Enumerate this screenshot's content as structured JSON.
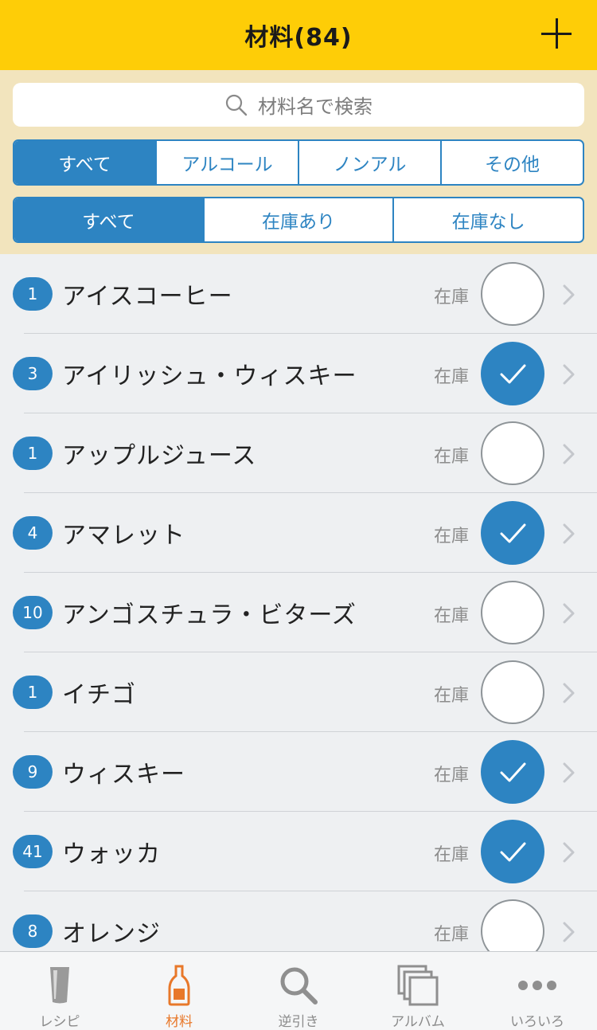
{
  "header": {
    "title": "材料(84)",
    "add_icon": "plus-icon"
  },
  "search": {
    "placeholder": "材料名で検索",
    "icon": "search-icon"
  },
  "category_filter": {
    "options": [
      "すべて",
      "アルコール",
      "ノンアル",
      "その他"
    ],
    "selected": "すべて"
  },
  "stock_filter": {
    "options": [
      "すべて",
      "在庫あり",
      "在庫なし"
    ],
    "selected": "すべて"
  },
  "ingredients": [
    {
      "count": "1",
      "name": "アイスコーヒー",
      "stock_label": "在庫",
      "in_stock": false
    },
    {
      "count": "3",
      "name": "アイリッシュ・ウィスキー",
      "stock_label": "在庫",
      "in_stock": true
    },
    {
      "count": "1",
      "name": "アップルジュース",
      "stock_label": "在庫",
      "in_stock": false
    },
    {
      "count": "4",
      "name": "アマレット",
      "stock_label": "在庫",
      "in_stock": true
    },
    {
      "count": "10",
      "name": "アンゴスチュラ・ビターズ",
      "stock_label": "在庫",
      "in_stock": false
    },
    {
      "count": "1",
      "name": "イチゴ",
      "stock_label": "在庫",
      "in_stock": false
    },
    {
      "count": "9",
      "name": "ウィスキー",
      "stock_label": "在庫",
      "in_stock": true
    },
    {
      "count": "41",
      "name": "ウォッカ",
      "stock_label": "在庫",
      "in_stock": true
    },
    {
      "count": "8",
      "name": "オレンジ",
      "stock_label": "在庫",
      "in_stock": false
    }
  ],
  "tabbar": {
    "tabs": [
      {
        "label": "レシピ",
        "icon": "glass-icon",
        "active": false
      },
      {
        "label": "材料",
        "icon": "bottle-icon",
        "active": true
      },
      {
        "label": "逆引き",
        "icon": "search-icon",
        "active": false
      },
      {
        "label": "アルバム",
        "icon": "album-icon",
        "active": false
      },
      {
        "label": "いろいろ",
        "icon": "more-icon",
        "active": false
      }
    ]
  },
  "colors": {
    "header_bg": "#fecd07",
    "filter_bg": "#f2e4bd",
    "accent_blue": "#2d84c2",
    "active_tab": "#e8782a"
  }
}
